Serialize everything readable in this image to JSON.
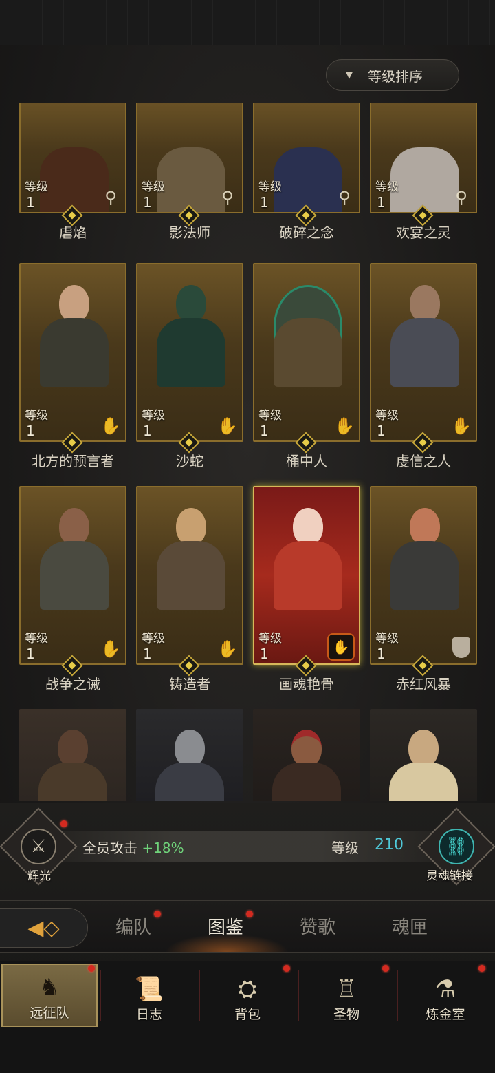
{
  "sort": {
    "label": "等级排序",
    "icon": "caret-down-icon"
  },
  "heroes": [
    {
      "name": "虐焰",
      "level_label": "等级",
      "level": "1",
      "class_icon": "key-icon"
    },
    {
      "name": "影法师",
      "level_label": "等级",
      "level": "1",
      "class_icon": "key-icon"
    },
    {
      "name": "破碎之念",
      "level_label": "等级",
      "level": "1",
      "class_icon": "key-icon"
    },
    {
      "name": "欢宴之灵",
      "level_label": "等级",
      "level": "1",
      "class_icon": "key-icon"
    },
    {
      "name": "北方的预言者",
      "level_label": "等级",
      "level": "1",
      "class_icon": "hand-icon"
    },
    {
      "name": "沙蛇",
      "level_label": "等级",
      "level": "1",
      "class_icon": "hand-icon"
    },
    {
      "name": "桶中人",
      "level_label": "等级",
      "level": "1",
      "class_icon": "hand-icon"
    },
    {
      "name": "虔信之人",
      "level_label": "等级",
      "level": "1",
      "class_icon": "hand-icon"
    },
    {
      "name": "战争之诫",
      "level_label": "等级",
      "level": "1",
      "class_icon": "hand-icon"
    },
    {
      "name": "铸造者",
      "level_label": "等级",
      "level": "1",
      "class_icon": "hand-icon"
    },
    {
      "name": "画魂艳骨",
      "level_label": "等级",
      "level": "1",
      "class_icon": "fire-hand-icon"
    },
    {
      "name": "赤红风暴",
      "level_label": "等级",
      "level": "1",
      "class_icon": "shield-icon"
    }
  ],
  "bonus": {
    "left_label": "辉光",
    "text": "全员攻击",
    "value": "+18%",
    "level_label": "等级",
    "level_value": "210",
    "right_label": "灵魂链接"
  },
  "tabs": [
    {
      "label": "编队"
    },
    {
      "label": "图鉴"
    },
    {
      "label": "赞歌"
    },
    {
      "label": "魂匣"
    }
  ],
  "nav": [
    {
      "label": "远征队",
      "icon": "viking-helmet-icon"
    },
    {
      "label": "日志",
      "icon": "scroll-icon"
    },
    {
      "label": "背包",
      "icon": "backpack-icon"
    },
    {
      "label": "圣物",
      "icon": "chalice-icon"
    },
    {
      "label": "炼金室",
      "icon": "alchemy-icon"
    }
  ],
  "colors": {
    "accent_gold": "#c8a83a",
    "level_cyan": "#4fc8d8",
    "bonus_green": "#6fd27a",
    "notify_red": "#d42a20"
  }
}
